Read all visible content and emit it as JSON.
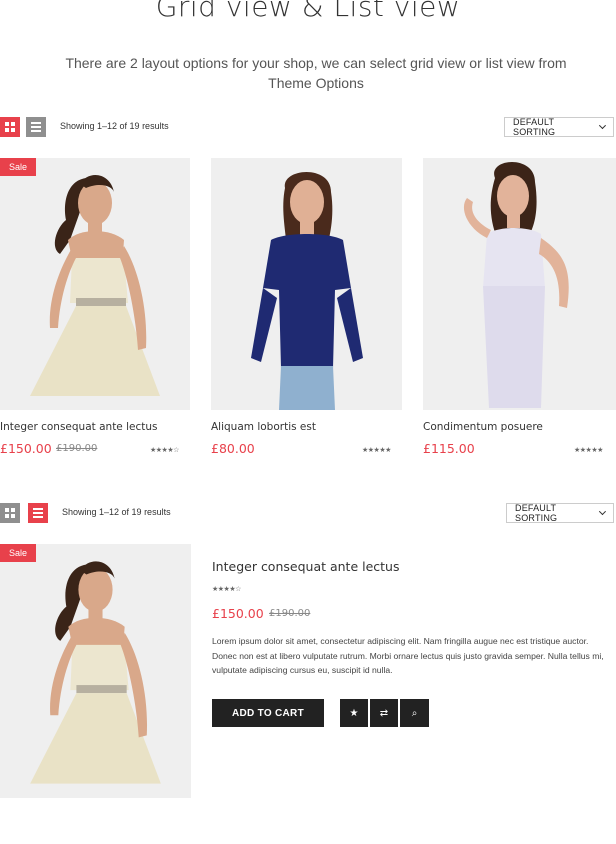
{
  "header": {
    "title": "Grid view & List view",
    "description": "There are 2 layout options for your shop, we can select grid view or list view from Theme Options"
  },
  "grid_section": {
    "results_text": "Showing 1–12 of 19 results",
    "sort_label": "DEFAULT SORTING",
    "products": [
      {
        "name": "Integer consequat ante lectus",
        "price": "£150.00",
        "old_price": "£190.00",
        "badge": "Sale",
        "rating": 4,
        "stars": "★★★★☆"
      },
      {
        "name": "Aliquam lobortis est",
        "price": "£80.00",
        "rating": 5,
        "stars": "★★★★★"
      },
      {
        "name": "Condimentum posuere",
        "price": "£115.00",
        "rating": 5,
        "stars": "★★★★★"
      }
    ]
  },
  "list_section": {
    "results_text": "Showing 1–12 of 19 results",
    "sort_label": "DEFAULT SORTING",
    "product": {
      "name": "Integer consequat ante lectus",
      "badge": "Sale",
      "rating": 4,
      "stars": "★★★★☆",
      "price": "£150.00",
      "old_price": "£190.00",
      "description": "Lorem ipsum dolor sit amet, consectetur adipiscing elit. Nam fringilla augue nec est tristique auctor. Donec non est at libero vulputate rutrum. Morbi ornare lectus quis justo gravida semper. Nulla tellus mi, vulputate adipiscing cursus eu, suscipit id nulla.",
      "add_to_cart": "ADD TO CART",
      "wishlist_icon": "★",
      "compare_icon": "⇄",
      "quickview_icon": "⌕"
    }
  },
  "colors": {
    "accent": "#e8414b",
    "dark": "#222222",
    "inactive": "#8f8f8f"
  }
}
